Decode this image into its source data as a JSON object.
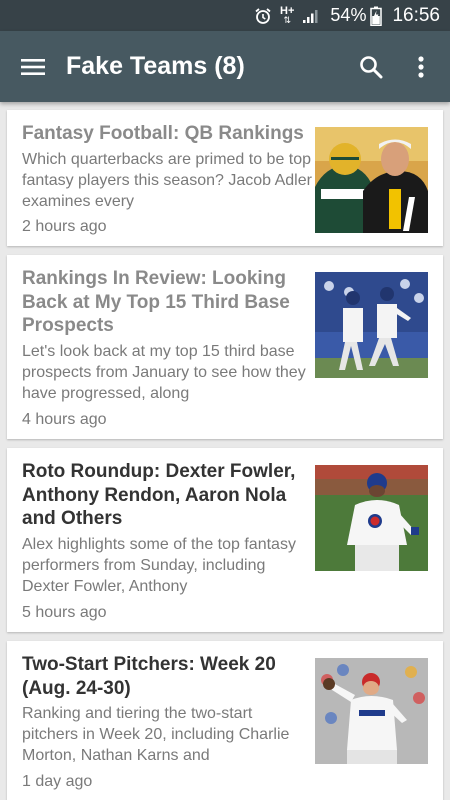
{
  "status_bar": {
    "alarm_icon": "alarm-clock-icon",
    "network_type": "H+",
    "battery": "54%",
    "time": "16:56"
  },
  "app_bar": {
    "title": "Fake Teams (8)",
    "menu_icon": "hamburger-menu-icon",
    "search_icon": "search-icon",
    "overflow_icon": "more-vert-icon"
  },
  "colors": {
    "status_bar_bg": "#374248",
    "app_bar_bg": "#475961",
    "background": "#e9e9e9",
    "read_title": "#8a8a8a",
    "unread_title": "#333333"
  },
  "articles": [
    {
      "title": "Fantasy Football: QB Rankings",
      "snippet": "Which quarterbacks are primed to be top fantasy players this season? Jacob Adler examines every",
      "time": "2 hours ago",
      "read": true,
      "image": "football-quarterbacks-photo"
    },
    {
      "title": "Rankings In Review: Looking Back at My Top 15 Third Base Prospects",
      "snippet": "Let's look back at my top 15 third base prospects from January to see how they have progressed, along",
      "time": "4 hours ago",
      "read": true,
      "image": "baseball-players-photo"
    },
    {
      "title": "Roto Roundup: Dexter Fowler, Anthony Rendon, Aaron Nola and Others",
      "snippet": "Alex highlights some of the top fantasy performers from Sunday, including Dexter Fowler, Anthony",
      "time": "5 hours ago",
      "read": false,
      "image": "cubs-batter-photo"
    },
    {
      "title": "Two-Start Pitchers: Week 20 (Aug. 24-30)",
      "snippet": "Ranking and tiering the two-start pitchers in Week 20, including Charlie Morton, Nathan Karns and",
      "time": "1 day ago",
      "read": false,
      "image": "rangers-pitcher-photo"
    }
  ]
}
